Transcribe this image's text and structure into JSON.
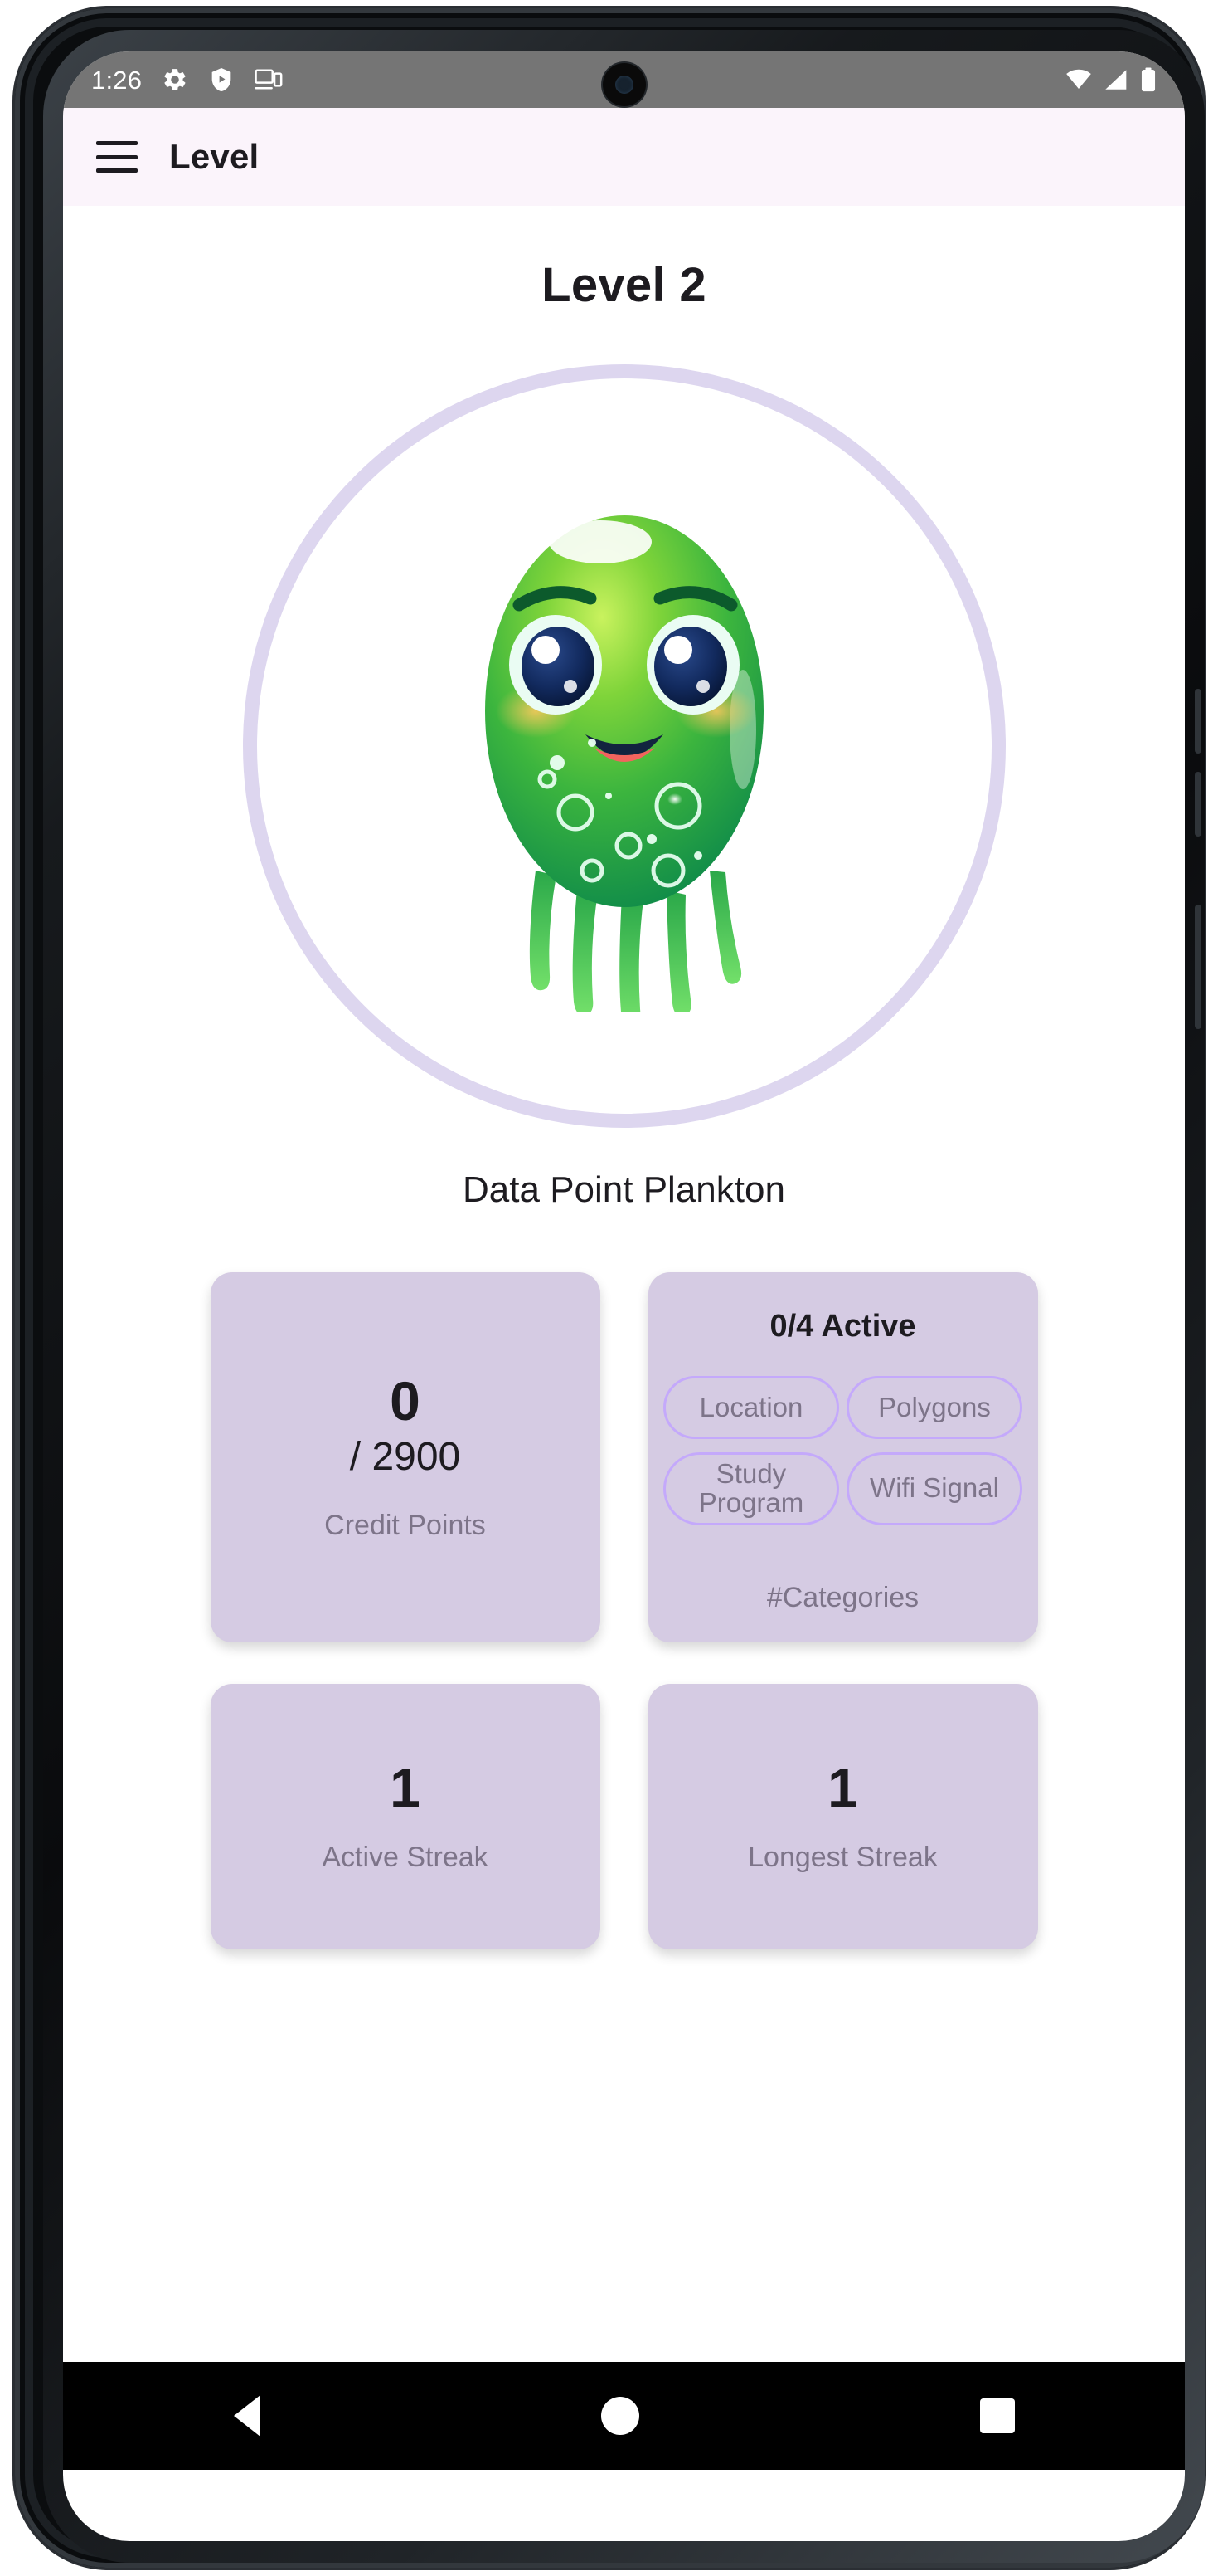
{
  "status_bar": {
    "time": "1:26",
    "left_icons": [
      "gear-icon",
      "shield-play-icon",
      "cast-screen-icon"
    ],
    "right_icons": [
      "wifi-icon",
      "cellular-signal-icon",
      "battery-icon"
    ]
  },
  "app_bar": {
    "menu_icon": "hamburger-menu-icon",
    "title": "Level"
  },
  "level": {
    "heading": "Level 2",
    "character_name": "Data Point Plankton",
    "character_art": "green-plankton-creature"
  },
  "stats": {
    "credit_points": {
      "value": "0",
      "target": "/ 2900",
      "label": "Credit Points"
    },
    "categories": {
      "title": "0/4 Active",
      "footer": "#Categories",
      "chips": [
        {
          "label": "Location",
          "active": false
        },
        {
          "label": "Polygons",
          "active": false
        },
        {
          "label": "Study Program",
          "active": false
        },
        {
          "label": "Wifi Signal",
          "active": false
        }
      ]
    },
    "active_streak": {
      "value": "1",
      "label": "Active Streak"
    },
    "longest_streak": {
      "value": "1",
      "label": "Longest Streak"
    }
  },
  "nav_bar": {
    "back": "back-triangle-icon",
    "home": "home-circle-icon",
    "recent": "recent-square-icon"
  },
  "colors": {
    "app_bar_bg": "#fbf4fb",
    "card_bg": "#d5cbe3",
    "ring": "#ddd6ef",
    "chip_border": "#c4a9fb",
    "muted_text": "#7d7489",
    "status_bar_bg": "#757575"
  }
}
